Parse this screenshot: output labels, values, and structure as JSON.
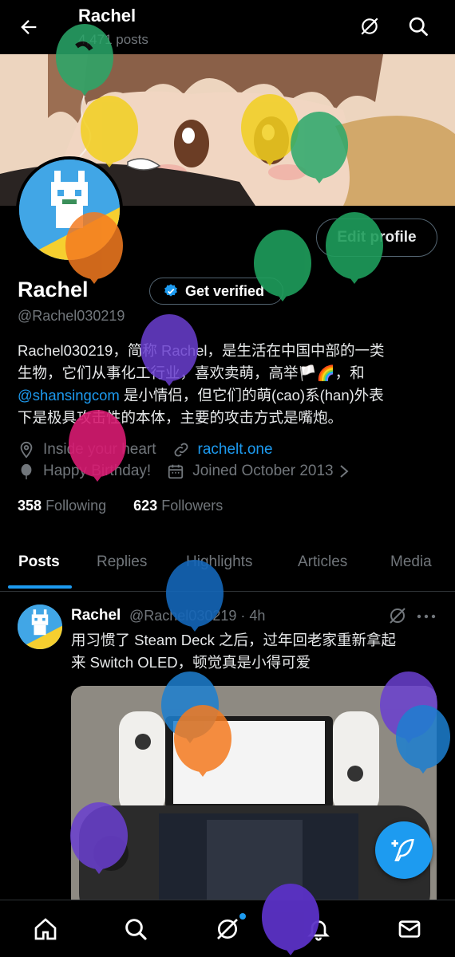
{
  "header": {
    "name": "Rachel",
    "posts_count": "4,471 posts"
  },
  "profile": {
    "edit_label": "Edit profile",
    "name": "Rachel",
    "verify_label": "Get verified",
    "handle": "@Rachel030219",
    "bio_line1": "Rachel030219，简称 Rachel，是生活在中国中部的一类",
    "bio_line2": "生物，它们从事化工行业，喜欢卖萌，高举🏳️🌈，和",
    "bio_mention": "@shansingcom",
    "bio_line3_rest": " 是小情侣，但它们的萌(cao)系(han)外表",
    "bio_line4": "下是极具攻击性的本体，主要的攻击方式是嘴炮。",
    "location": "Inside your heart",
    "website": "rachelt.one",
    "birthday": "Happy Birthday!",
    "joined": "Joined October 2013",
    "following_count": "358",
    "following_label": "Following",
    "followers_count": "623",
    "followers_label": "Followers"
  },
  "tabs": [
    "Posts",
    "Replies",
    "Highlights",
    "Articles",
    "Media"
  ],
  "post": {
    "name": "Rachel",
    "handle_time": "@Rachel030219 · 4h",
    "text_line1": "用习惯了 Steam Deck 之后，过年回老家重新拿起",
    "text_line2": "来 Switch OLED，顿觉真是小得可爱"
  },
  "colors": {
    "accent": "#1d9bf0",
    "background": "#000000",
    "muted": "#71767b"
  },
  "icons": {
    "back": "arrow-left-icon",
    "grok": "grok-icon",
    "search": "search-icon",
    "home": "home-icon",
    "notifications": "bell-icon",
    "messages": "mail-icon",
    "compose": "feather-plus-icon"
  }
}
